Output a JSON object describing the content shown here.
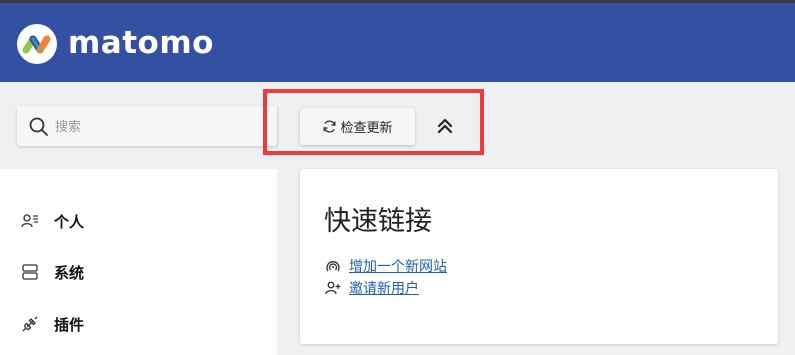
{
  "app": {
    "logo_text": "matomo",
    "header_color": "#3450a3"
  },
  "search": {
    "placeholder": "搜索"
  },
  "toolbar": {
    "check_updates_label": "检查更新"
  },
  "sidebar": {
    "items": [
      {
        "label": "个人",
        "icon": "personal-icon"
      },
      {
        "label": "系统",
        "icon": "system-icon"
      },
      {
        "label": "插件",
        "icon": "plugin-icon"
      }
    ]
  },
  "quick_links": {
    "title": "快速链接",
    "links": [
      {
        "label": "增加一个新网站",
        "icon": "add-website-icon"
      },
      {
        "label": "邀请新用户",
        "icon": "invite-user-icon"
      }
    ]
  }
}
